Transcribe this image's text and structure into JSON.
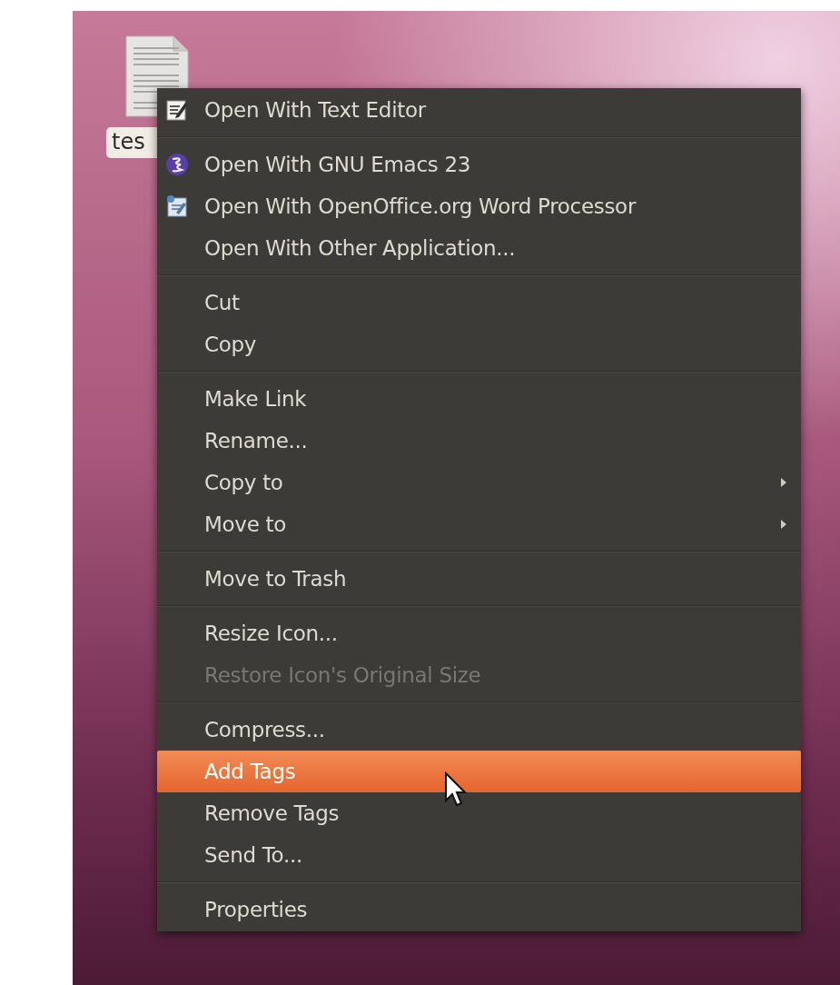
{
  "desktop": {
    "file_icon": {
      "label": "tes"
    }
  },
  "menu": {
    "groups": [
      {
        "items": [
          {
            "label": "Open With Text Editor",
            "kind": "editor",
            "submenu": false,
            "disabled": false,
            "selected": false
          }
        ]
      },
      {
        "items": [
          {
            "label": "Open With GNU Emacs 23",
            "kind": "emacs",
            "submenu": false,
            "disabled": false,
            "selected": false
          },
          {
            "label": "Open With OpenOffice.org Word Processor",
            "kind": "office",
            "submenu": false,
            "disabled": false,
            "selected": false
          },
          {
            "label": "Open With Other Application...",
            "kind": "plain",
            "submenu": false,
            "disabled": false,
            "selected": false
          }
        ]
      },
      {
        "items": [
          {
            "label": "Cut",
            "kind": "plain",
            "submenu": false,
            "disabled": false,
            "selected": false
          },
          {
            "label": "Copy",
            "kind": "plain",
            "submenu": false,
            "disabled": false,
            "selected": false
          }
        ]
      },
      {
        "items": [
          {
            "label": "Make Link",
            "kind": "plain",
            "submenu": false,
            "disabled": false,
            "selected": false
          },
          {
            "label": "Rename...",
            "kind": "plain",
            "submenu": false,
            "disabled": false,
            "selected": false
          },
          {
            "label": "Copy to",
            "kind": "plain",
            "submenu": true,
            "disabled": false,
            "selected": false
          },
          {
            "label": "Move to",
            "kind": "plain",
            "submenu": true,
            "disabled": false,
            "selected": false
          }
        ]
      },
      {
        "items": [
          {
            "label": "Move to Trash",
            "kind": "plain",
            "submenu": false,
            "disabled": false,
            "selected": false
          }
        ]
      },
      {
        "items": [
          {
            "label": "Resize Icon...",
            "kind": "plain",
            "submenu": false,
            "disabled": false,
            "selected": false
          },
          {
            "label": "Restore Icon's Original Size",
            "kind": "plain",
            "submenu": false,
            "disabled": true,
            "selected": false
          }
        ]
      },
      {
        "items": [
          {
            "label": "Compress...",
            "kind": "plain",
            "submenu": false,
            "disabled": false,
            "selected": false
          },
          {
            "label": "Add Tags",
            "kind": "plain",
            "submenu": false,
            "disabled": false,
            "selected": true
          },
          {
            "label": "Remove Tags",
            "kind": "plain",
            "submenu": false,
            "disabled": false,
            "selected": false
          },
          {
            "label": "Send To...",
            "kind": "plain",
            "submenu": false,
            "disabled": false,
            "selected": false
          }
        ]
      },
      {
        "items": [
          {
            "label": "Properties",
            "kind": "plain",
            "submenu": false,
            "disabled": false,
            "selected": false
          }
        ]
      }
    ]
  }
}
